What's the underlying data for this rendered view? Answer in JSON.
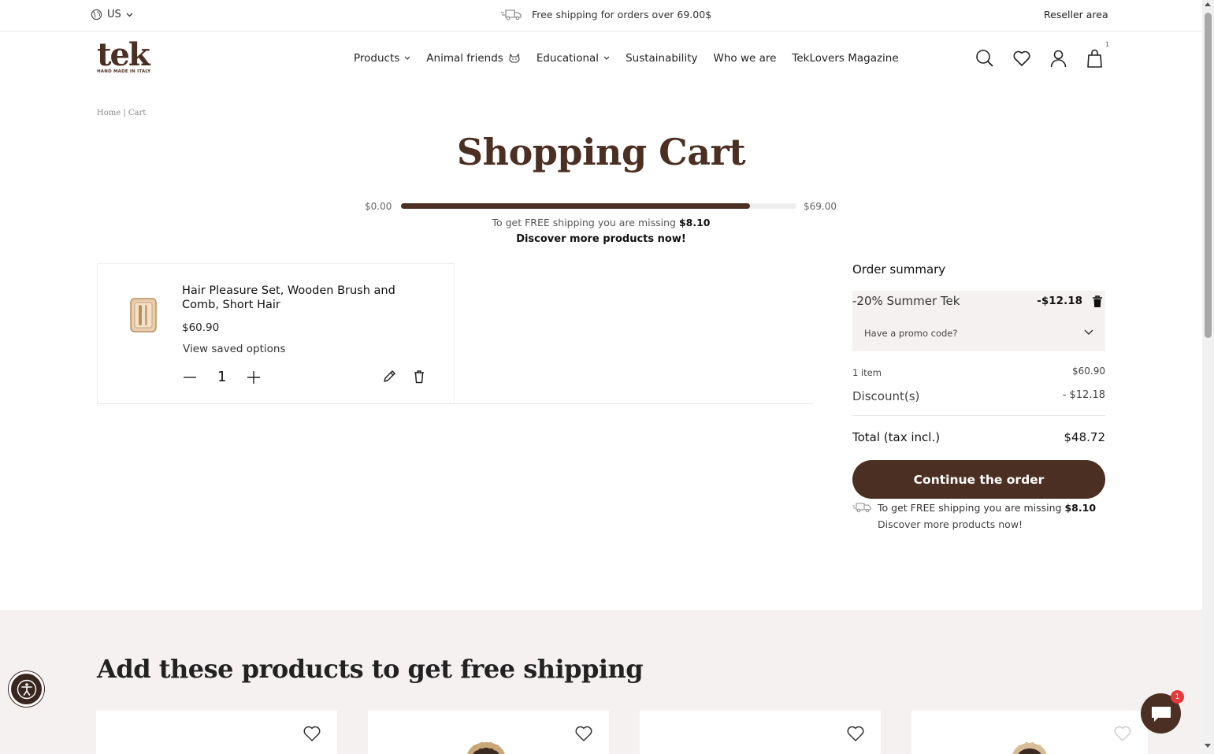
{
  "topbar": {
    "region": "US",
    "shipping_message": "Free shipping for orders over 69.00$",
    "reseller_label": "Reseller area"
  },
  "header": {
    "logo_text": "tek",
    "logo_tagline": "HAND MADE IN ITALY",
    "nav": [
      {
        "label": "Products",
        "has_dropdown": true
      },
      {
        "label": "Animal friends",
        "has_dropdown": false
      },
      {
        "label": "Educational",
        "has_dropdown": true
      },
      {
        "label": "Sustainability",
        "has_dropdown": false
      },
      {
        "label": "Who we are",
        "has_dropdown": false
      },
      {
        "label": "TekLovers Magazine",
        "has_dropdown": false
      }
    ],
    "icons": [
      "search-icon",
      "heart-icon",
      "user-icon",
      "cart-icon"
    ],
    "cart_count": "1"
  },
  "breadcrumb": {
    "home": "Home",
    "separator": "|",
    "current": "Cart"
  },
  "page_title": "Shopping Cart",
  "free_shipping": {
    "min_label": "$0.00",
    "max_label": "$69.00",
    "progress": 0.8826,
    "message_prefix": "To get FREE shipping you are missing",
    "missing_amount": "$8.10",
    "cta": "Discover more products now!"
  },
  "cart_item": {
    "name": "Hair Pleasure Set, Wooden Brush and Comb, Short Hair",
    "price": "$60.90",
    "options_link": "View saved options",
    "quantity": "1"
  },
  "summary": {
    "title": "Order summary",
    "promo_name": "-20% Summer Tek",
    "promo_amount": "-$12.18",
    "promo_field_label": "Have a promo code?",
    "items_label": "1 item",
    "items_value": "$60.90",
    "discount_label": "Discount(s)",
    "discount_value": "- $12.18",
    "total_label": "Total (tax incl.)",
    "total_value": "$48.72",
    "continue_label": "Continue the order",
    "shipping_prefix": "To get FREE shipping you are missing",
    "shipping_amount": "$8.10",
    "shipping_cta": "Discover more products now!"
  },
  "upsell": {
    "title": "Add these products to get free shipping"
  },
  "chat": {
    "badge": "1"
  },
  "colors": {
    "brand": "#4b2f23",
    "section_bg": "#f6f1f1",
    "badge": "#e23b3b"
  }
}
